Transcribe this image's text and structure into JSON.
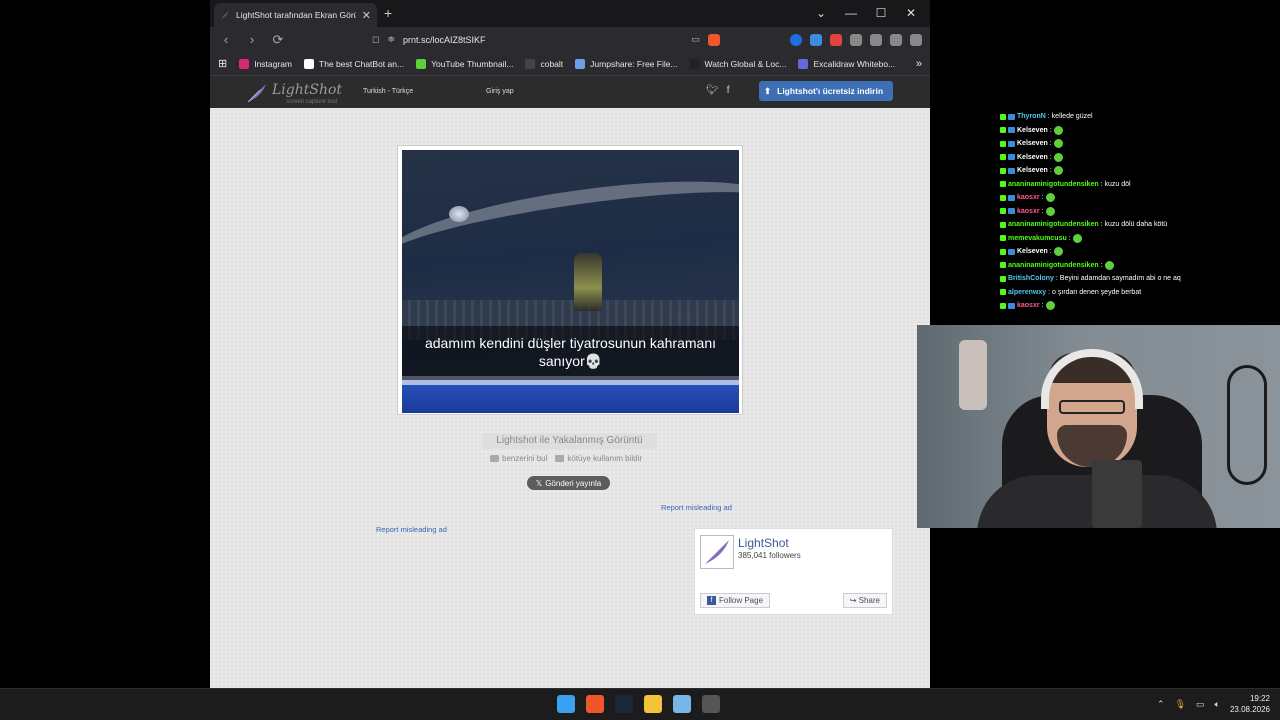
{
  "browser": {
    "tab_title": "LightShot tarafından Ekran Görü",
    "tab_close": "✕",
    "new_tab": "+",
    "window_controls": [
      "⌄",
      "—",
      "☐",
      "✕"
    ],
    "url": "prnt.sc/locAIZ8tSIKF",
    "bookmarks": [
      {
        "label": "Instagram",
        "color": "#d62976"
      },
      {
        "label": "The best ChatBot an...",
        "color": "#ffffff"
      },
      {
        "label": "YouTube Thumbnail...",
        "color": "#5fcf3e"
      },
      {
        "label": "cobalt",
        "color": "#444444"
      },
      {
        "label": "Jumpshare: Free File...",
        "color": "#6aa0e8"
      },
      {
        "label": "Watch Global & Loc...",
        "color": "#222222"
      },
      {
        "label": "Excalidraw Whitebo...",
        "color": "#6965db"
      }
    ],
    "bookmarks_overflow": "»"
  },
  "lightshot": {
    "brand": "LightShot",
    "tagline": "screen capture tool",
    "language": "Turkish - Türkçe",
    "login": "Giriş yap",
    "download_button": "Lightshot'ı ücretsiz indirin",
    "screenshot_caption": "adamım kendini düşler tiyatrosunun kahramanı sanıyor💀",
    "shot_title": "Lightshot ile Yakalanmış Görüntü",
    "find_similar": "benzerini bul",
    "report_abuse": "kötüye kullanım bildir",
    "tweet_button": "Gönderi yayınla",
    "report_ad_1": "Report misleading ad",
    "report_ad_2": "Report misleading ad",
    "fb": {
      "name": "LightShot",
      "followers": "385,041 followers",
      "follow": "Follow Page",
      "share": "Share"
    }
  },
  "chat": [
    {
      "user": "ThyronN",
      "user_color": "#53c8f0",
      "msg": ": kellede güzel",
      "emote": false,
      "badge2": true
    },
    {
      "user": "Kelseven",
      "user_color": "#ffffff",
      "msg": ":",
      "emote": true,
      "badge2": true
    },
    {
      "user": "Kelseven",
      "user_color": "#ffffff",
      "msg": ":",
      "emote": true,
      "badge2": true
    },
    {
      "user": "Kelseven",
      "user_color": "#ffffff",
      "msg": ":",
      "emote": true,
      "badge2": true
    },
    {
      "user": "Kelseven",
      "user_color": "#ffffff",
      "msg": ":",
      "emote": true,
      "badge2": true
    },
    {
      "user": "ananinaminigotundensiken",
      "user_color": "#53fc18",
      "msg": ": kuzu döl",
      "emote": false,
      "badge2": false
    },
    {
      "user": "kaosxr",
      "user_color": "#ff5c8a",
      "msg": ":",
      "emote": true,
      "badge2": true
    },
    {
      "user": "kaosxr",
      "user_color": "#ff5c8a",
      "msg": ":",
      "emote": true,
      "badge2": true
    },
    {
      "user": "ananinaminigotundensiken",
      "user_color": "#53fc18",
      "msg": ": kuzu dölü daha kötü",
      "emote": false,
      "badge2": false
    },
    {
      "user": "memevakumcusu",
      "user_color": "#53fc18",
      "msg": ":",
      "emote": true,
      "badge2": false
    },
    {
      "user": "Kelseven",
      "user_color": "#ffffff",
      "msg": ":",
      "emote": true,
      "badge2": true
    },
    {
      "user": "ananinaminigotundensiken",
      "user_color": "#53fc18",
      "msg": ":",
      "emote": true,
      "badge2": false
    },
    {
      "user": "BritishColony",
      "user_color": "#53c8f0",
      "msg": ": Beyini adamdan saymadım abi o ne aq",
      "emote": false,
      "badge2": false
    },
    {
      "user": "alperenwxy",
      "user_color": "#53c8f0",
      "msg": ": o şırdan denen şeyde berbat",
      "emote": false,
      "badge2": false
    },
    {
      "user": "kaosxr",
      "user_color": "#ff5c8a",
      "msg": ":",
      "emote": true,
      "badge2": true
    }
  ],
  "taskbar": {
    "apps": [
      {
        "name": "windows-start",
        "color": "#3aa0f0"
      },
      {
        "name": "brave",
        "color": "#f0562c"
      },
      {
        "name": "steam",
        "color": "#1b2838"
      },
      {
        "name": "file-explorer",
        "color": "#f3c33b"
      },
      {
        "name": "photos",
        "color": "#7ab6e8"
      },
      {
        "name": "app-red-badge",
        "color": "#555555"
      }
    ],
    "time": "19:22",
    "date": "23.08.2026"
  }
}
